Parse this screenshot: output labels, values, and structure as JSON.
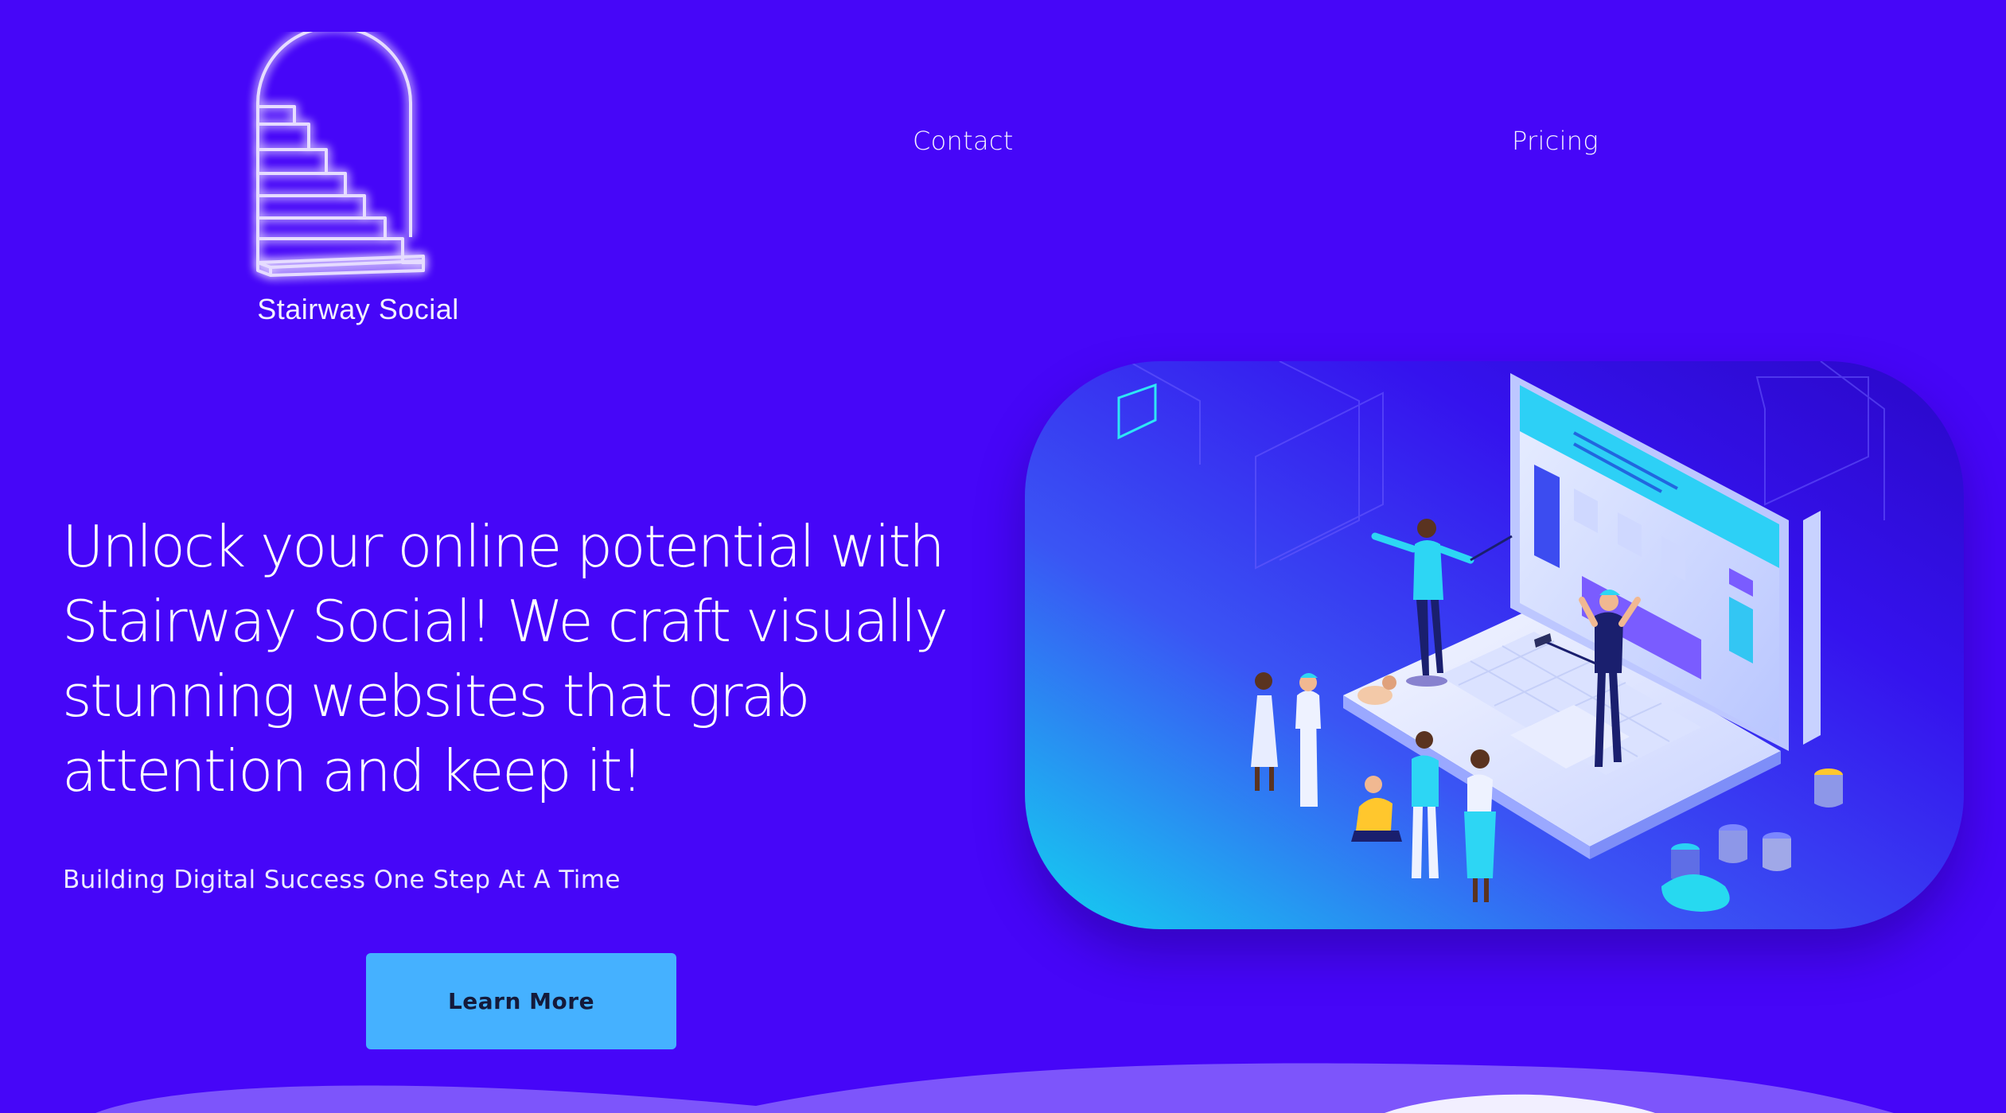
{
  "brand": {
    "name": "Stairway Social",
    "logo_icon": "stairway-arch-icon"
  },
  "nav": {
    "contact": "Contact",
    "pricing": "Pricing"
  },
  "hero": {
    "headline": "Unlock your online potential with Stairway Social! We craft visually stunning websites that grab attention and keep it!",
    "subheadline": "Building Digital Success One Step At A Time",
    "cta_label": "Learn More",
    "illustration_icon": "web-design-team-illustration-icon"
  },
  "colors": {
    "background": "#4606f8",
    "cta_background": "#45b1ff",
    "cta_text": "#141a3a",
    "logo_glow": "#d9c6ff",
    "wave": "#7d55fb"
  }
}
